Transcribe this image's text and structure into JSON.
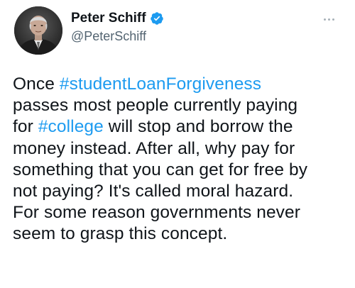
{
  "author": {
    "display_name": "Peter Schiff",
    "handle": "@PeterSchiff",
    "verified": true,
    "avatar_icon": "profile-photo",
    "verified_icon": "verified-badge-icon",
    "verified_color": "#1d9bf0"
  },
  "menu": {
    "more_icon": "more-horizontal-icon"
  },
  "tweet": {
    "lines": [
      [
        {
          "text": "Once ",
          "type": "text"
        },
        {
          "text": "#studentLoanForgiveness",
          "type": "hashtag"
        }
      ],
      [
        {
          "text": "passes most people currently paying",
          "type": "text"
        }
      ],
      [
        {
          "text": "for ",
          "type": "text"
        },
        {
          "text": "#college",
          "type": "hashtag"
        },
        {
          "text": " will stop and borrow the",
          "type": "text"
        }
      ],
      [
        {
          "text": "money instead. After all, why pay for",
          "type": "text"
        }
      ],
      [
        {
          "text": "something that you can get for free by",
          "type": "text"
        }
      ],
      [
        {
          "text": "not paying? It's called moral hazard.",
          "type": "text"
        }
      ],
      [
        {
          "text": "For some reason governments never",
          "type": "text"
        }
      ],
      [
        {
          "text": "seem to grasp this concept.",
          "type": "text"
        }
      ]
    ]
  },
  "colors": {
    "text": "#0f1419",
    "secondary": "#536471",
    "link": "#1d9bf0"
  }
}
